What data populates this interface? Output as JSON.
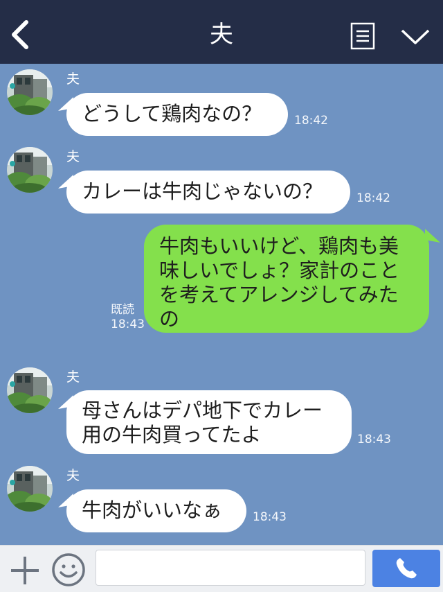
{
  "header": {
    "title": "夫",
    "back_icon": "chevron-left-icon",
    "menu_icon": "list-icon",
    "dropdown_icon": "chevron-down-icon",
    "background": "#242d47"
  },
  "chat": {
    "background": "#6f93c2",
    "messages": [
      {
        "direction": "in",
        "sender": "夫",
        "text": "どうして鶏肉なの？",
        "time": "18:42"
      },
      {
        "direction": "in",
        "sender": "夫",
        "text": "カレーは牛肉じゃないの？",
        "time": "18:42"
      },
      {
        "direction": "out",
        "lines": [
          "牛肉もいいけど、鶏肉も美",
          "味しいでしょ？家計のこと",
          "を考えてアレンジしてみた",
          "の"
        ],
        "read": "既読",
        "time": "18:43"
      },
      {
        "direction": "in",
        "sender": "夫",
        "lines": [
          "母さんはデパ地下でカレー",
          "用の牛肉買ってたよ"
        ],
        "time": "18:43"
      },
      {
        "direction": "in",
        "sender": "夫",
        "text": "牛肉がいいなぁ",
        "time": "18:43"
      }
    ]
  },
  "input_bar": {
    "plus_icon": "plus-icon",
    "sticker_icon": "smile-icon",
    "message_value": "",
    "call_icon": "phone-icon",
    "call_color": "#4c82e3"
  },
  "colors": {
    "incoming_bubble": "#ffffff",
    "outgoing_bubble": "#84e04c"
  }
}
